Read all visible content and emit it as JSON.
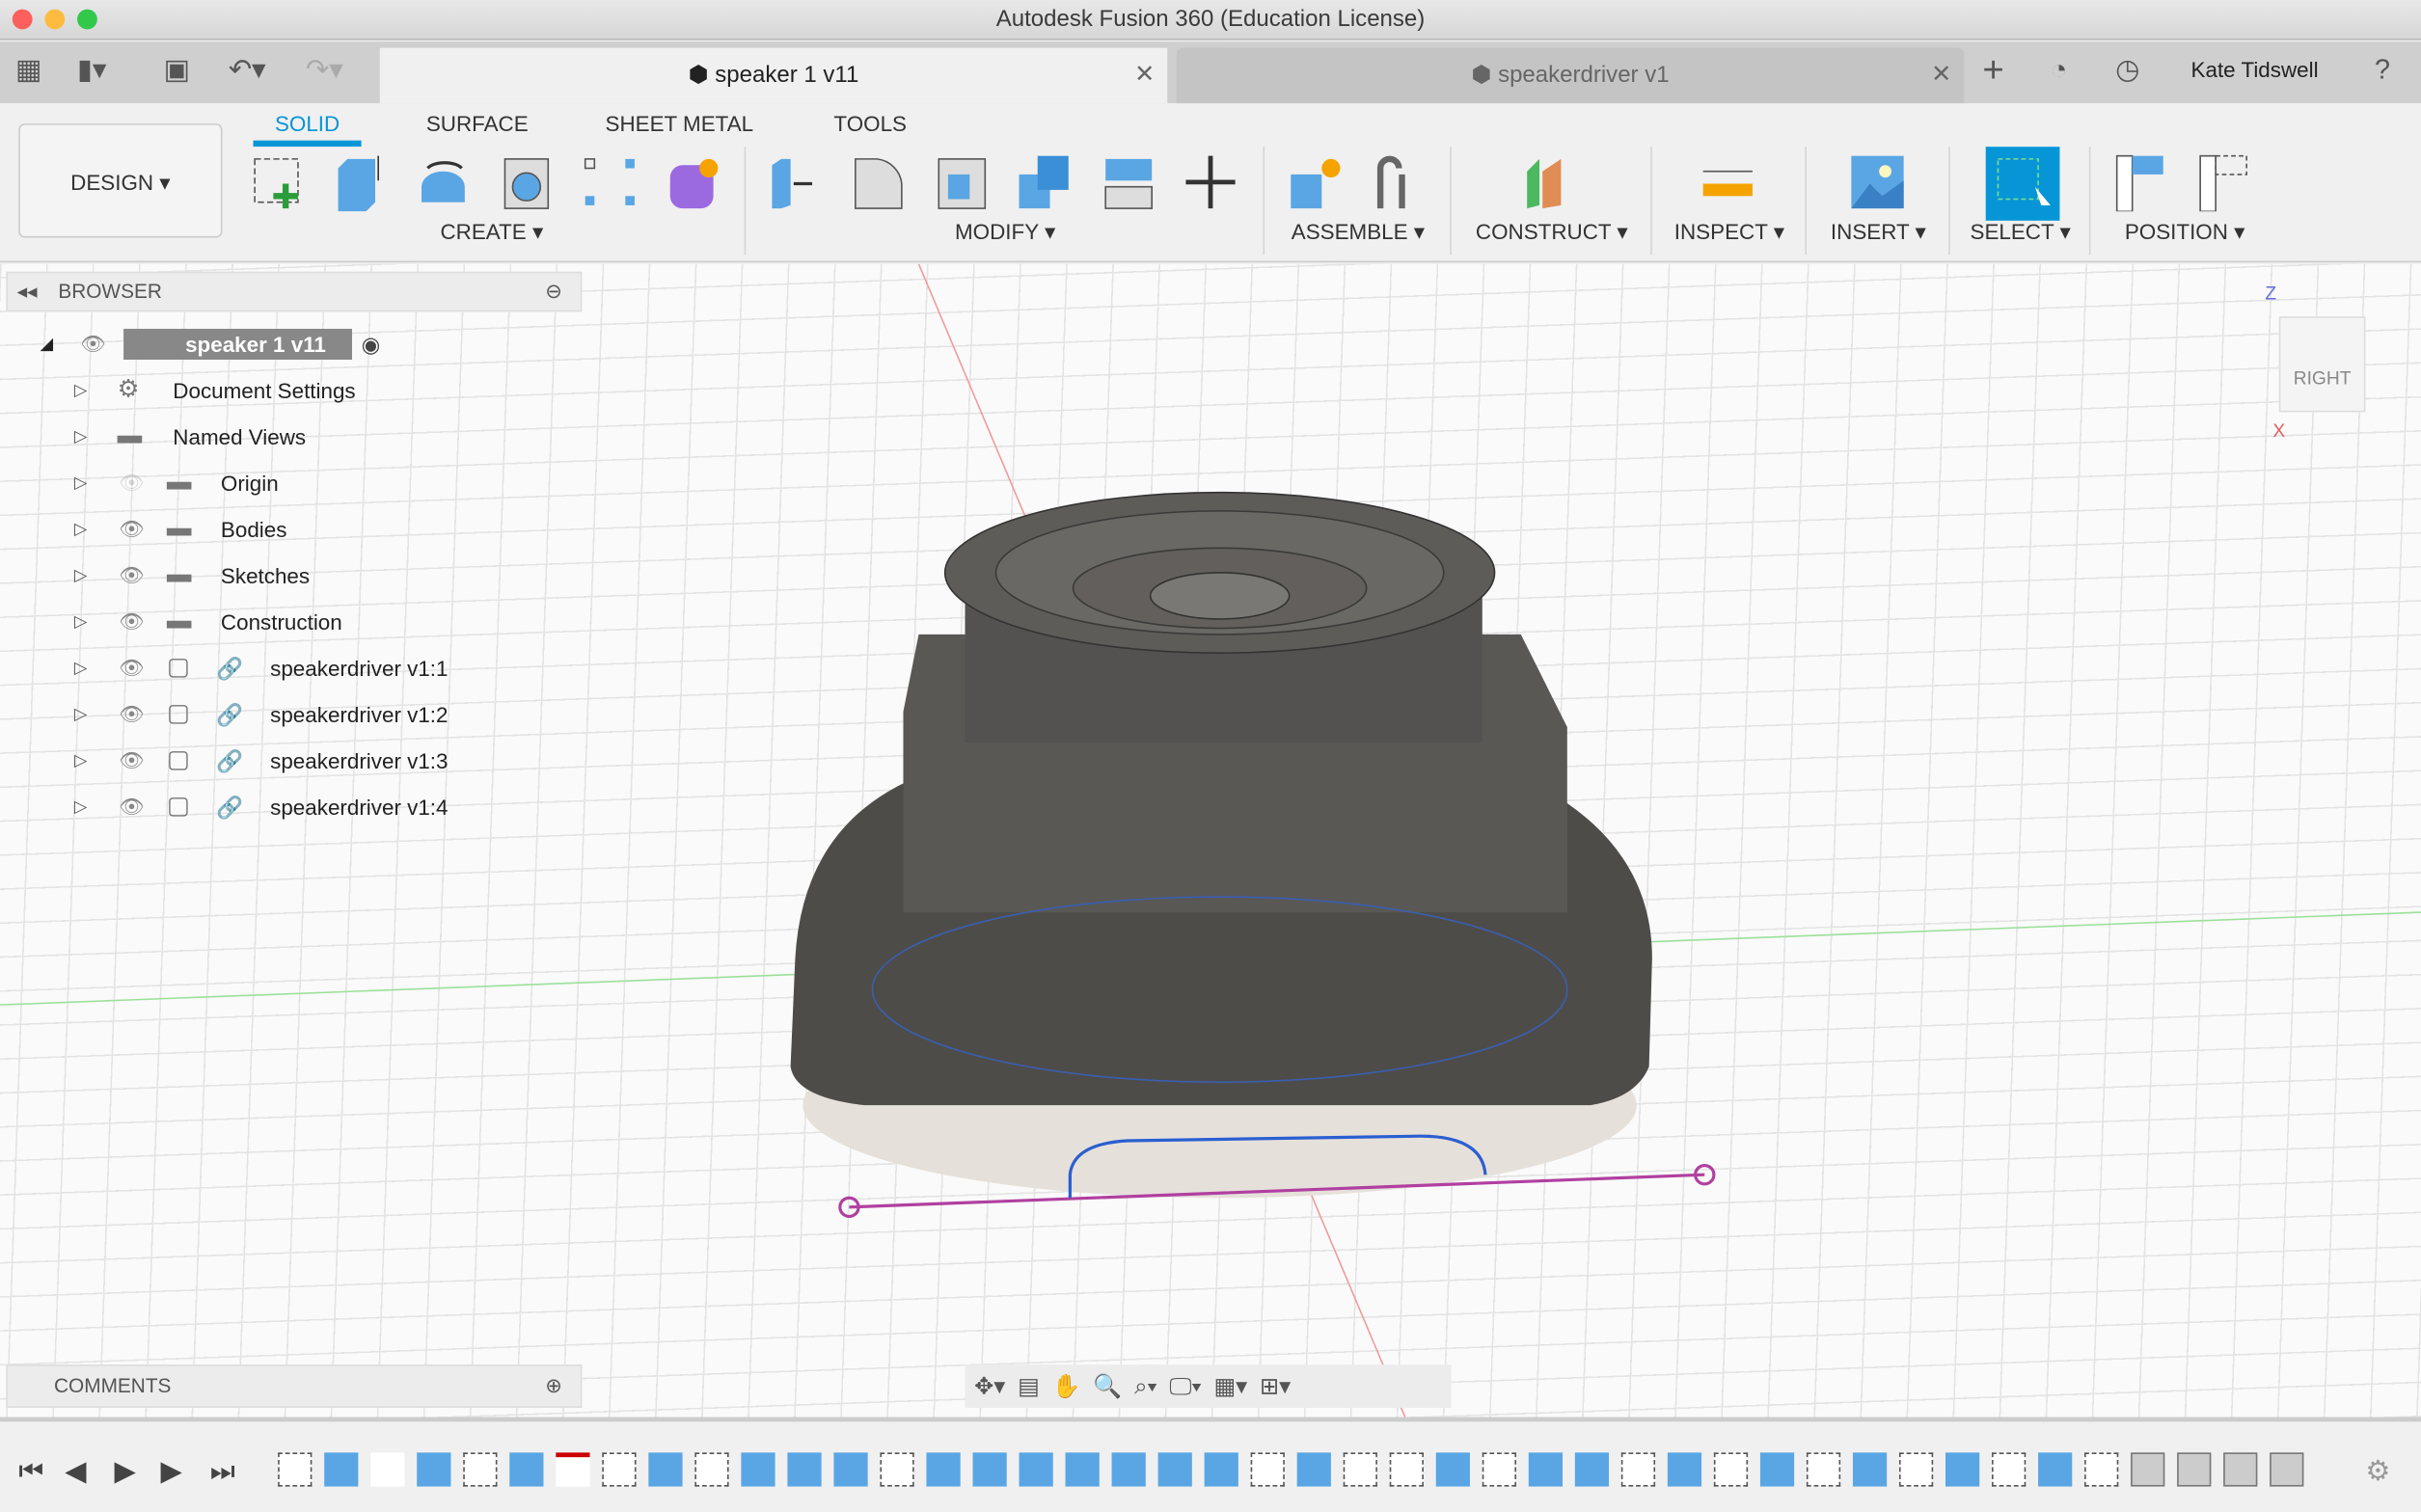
{
  "window": {
    "title": "Autodesk Fusion 360 (Education License)"
  },
  "tabs": [
    {
      "label": "speaker 1 v11",
      "active": true
    },
    {
      "label": "speakerdriver v1",
      "active": false
    }
  ],
  "user": {
    "name": "Kate Tidswell"
  },
  "toolbar": {
    "workspace": "DESIGN",
    "tabs": [
      "SOLID",
      "SURFACE",
      "SHEET METAL",
      "TOOLS"
    ],
    "active_tab": "SOLID",
    "groups": [
      "CREATE",
      "MODIFY",
      "ASSEMBLE",
      "CONSTRUCT",
      "INSPECT",
      "INSERT",
      "SELECT",
      "POSITION"
    ],
    "accent": "#0696d7"
  },
  "browser": {
    "title": "BROWSER",
    "root": "speaker 1 v11",
    "items": [
      {
        "label": "Document Settings",
        "icon": "gear-icon"
      },
      {
        "label": "Named Views",
        "icon": "folder-icon"
      },
      {
        "label": "Origin",
        "icon": "folder-icon",
        "hidden": true
      },
      {
        "label": "Bodies",
        "icon": "folder-icon"
      },
      {
        "label": "Sketches",
        "icon": "folder-icon"
      },
      {
        "label": "Construction",
        "icon": "folder-icon"
      },
      {
        "label": "speakerdriver v1:1",
        "icon": "component-link-icon"
      },
      {
        "label": "speakerdriver v1:2",
        "icon": "component-link-icon"
      },
      {
        "label": "speakerdriver v1:3",
        "icon": "component-link-icon"
      },
      {
        "label": "speakerdriver v1:4",
        "icon": "component-link-icon"
      }
    ]
  },
  "comments": {
    "title": "COMMENTS"
  },
  "viewcube": {
    "face": "RIGHT",
    "axis_z": "Z",
    "axis_x": "X"
  },
  "timeline": {
    "features": [
      "sketch",
      "point",
      "move",
      "extrude",
      "sketch",
      "extrude",
      "delete-body",
      "sketch",
      "extrude",
      "sketch",
      "extrude",
      "extrude",
      "extrude",
      "sketch",
      "extrude",
      "extrude",
      "extrude",
      "extrude",
      "extrude",
      "extrude",
      "extrude",
      "sketch",
      "extrude",
      "sketch",
      "sketch",
      "extrude",
      "sketch",
      "extrude",
      "extrude",
      "sketch",
      "extrude",
      "sketch",
      "extrude",
      "sketch",
      "extrude",
      "sketch",
      "extrude",
      "sketch",
      "extrude",
      "sketch",
      "joint",
      "joint",
      "joint",
      "joint"
    ]
  }
}
